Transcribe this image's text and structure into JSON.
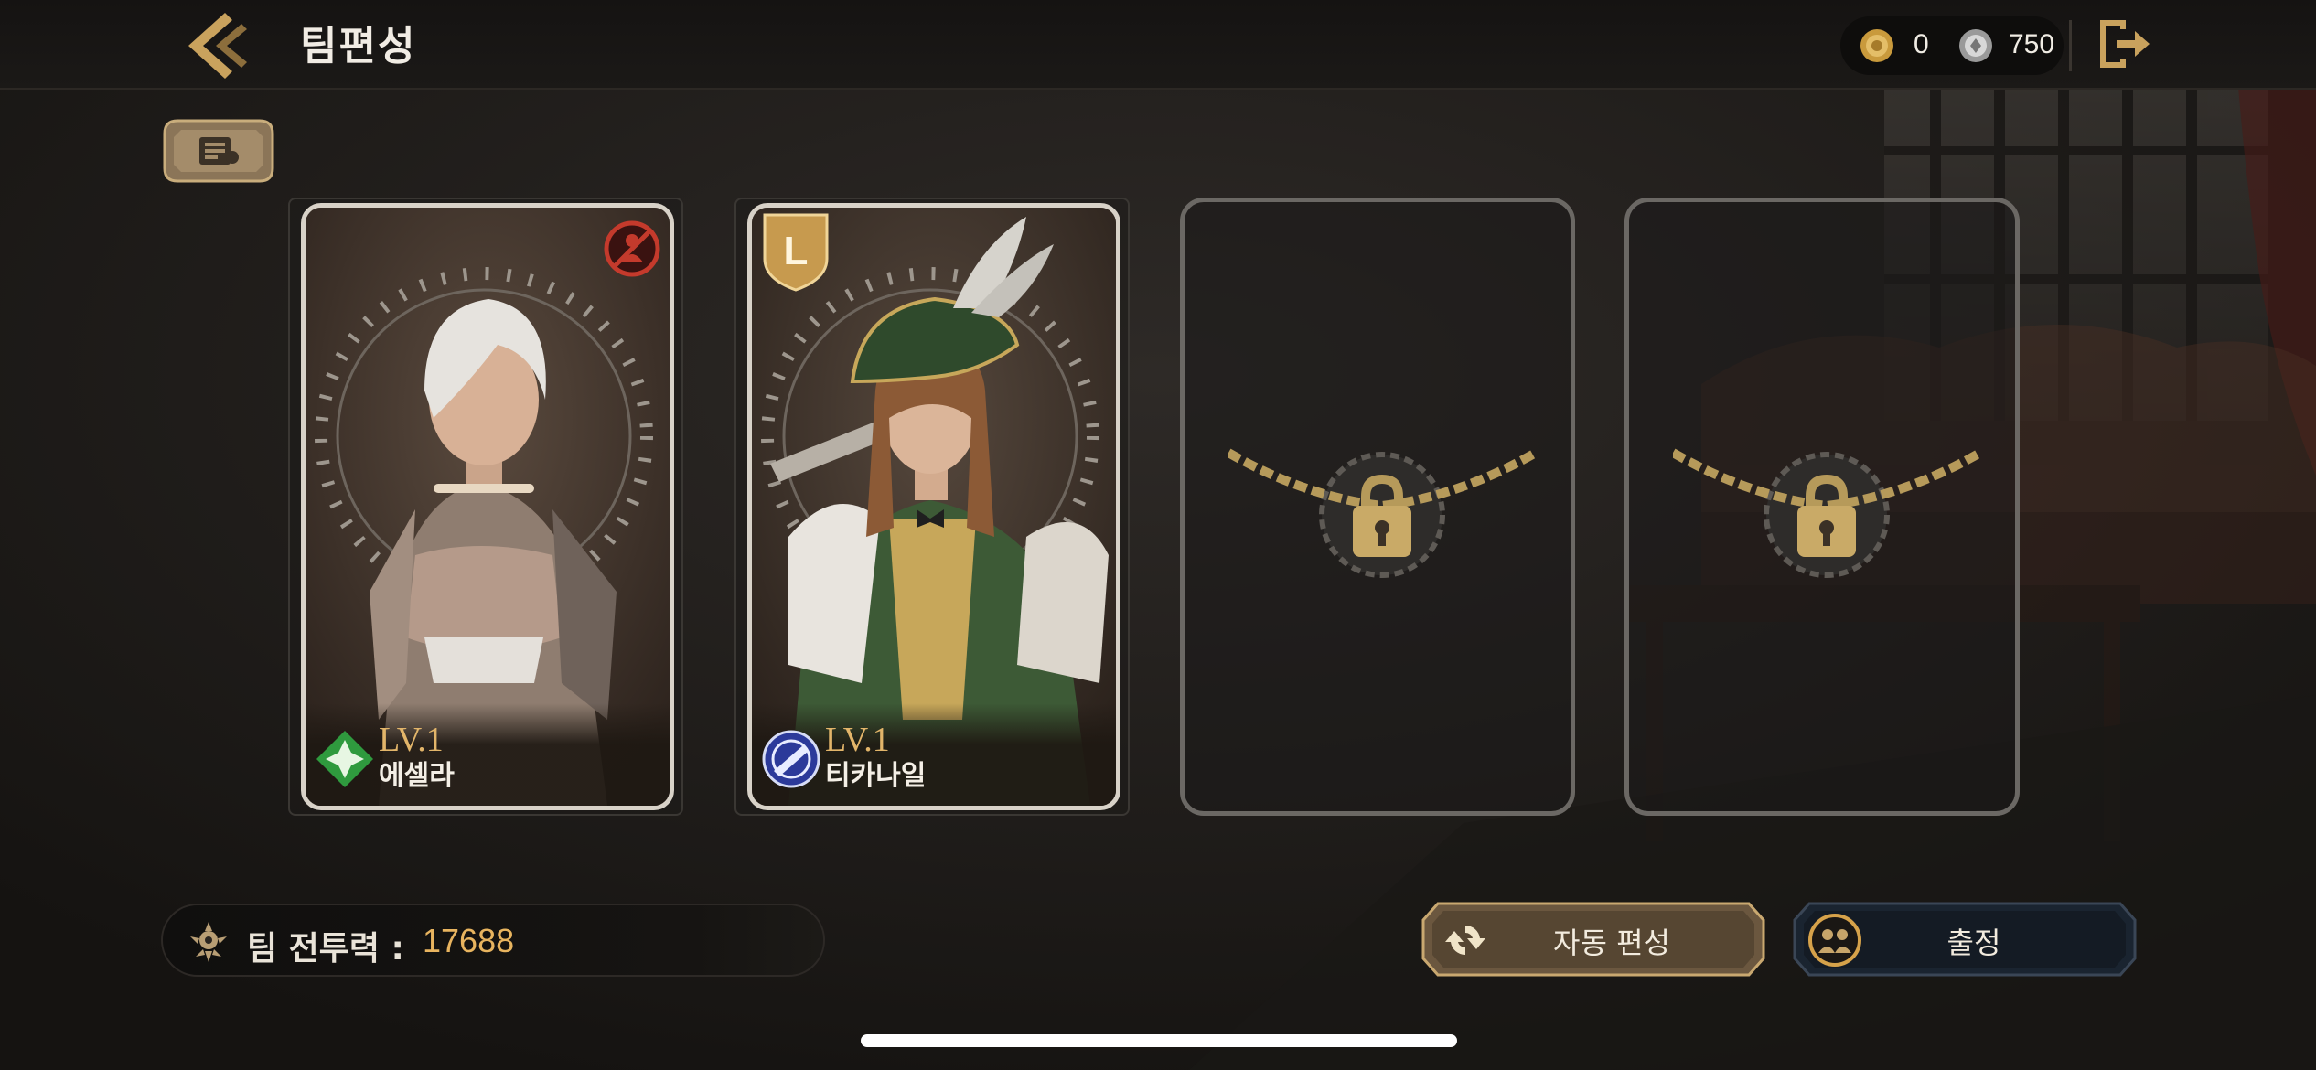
{
  "header": {
    "title": "팀편성",
    "back_icon": "double-chevron-left-icon",
    "exit_icon": "exit-door-icon"
  },
  "currency": {
    "gold": {
      "icon": "gold-coin-icon",
      "value": "0"
    },
    "silver": {
      "icon": "silver-coin-icon",
      "value": "750"
    }
  },
  "menu_button": {
    "icon": "list-card-icon"
  },
  "team_slots": [
    {
      "type": "character",
      "level": "LV.1",
      "name": "에셀라",
      "class_icon": "green-diamond-class-icon",
      "badge_icon": "restricted-figure-badge-icon",
      "colors": {
        "hair": "#e6e3de",
        "outfit": "#9b8f86"
      }
    },
    {
      "type": "character",
      "level": "LV.1",
      "name": "티카나일",
      "class_icon": "blue-gun-class-icon",
      "badge_icon": "leader-L-badge-icon",
      "badge_text": "L",
      "colors": {
        "hair": "#8c5a36",
        "outfit": "#3d5a36"
      }
    },
    {
      "type": "locked",
      "icon": "chain-padlock-icon"
    },
    {
      "type": "locked",
      "icon": "chain-padlock-icon"
    }
  ],
  "team_power": {
    "label": "팀 전투력 :",
    "value": "17688",
    "icon": "crest-icon"
  },
  "buttons": {
    "auto_form": {
      "label": "자동 편성",
      "icon": "refresh-icon"
    },
    "sortie": {
      "label": "출정",
      "icon": "party-icon"
    }
  },
  "colors": {
    "accent_gold": "#e8b45f",
    "card_border": "#d8d2c8",
    "locked_border": "#6b6864"
  }
}
